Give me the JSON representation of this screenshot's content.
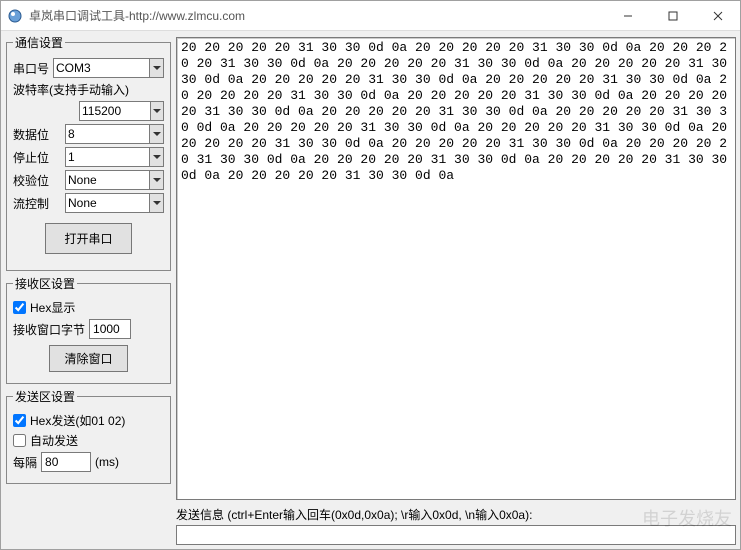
{
  "window": {
    "title": "卓岚串口调试工具-http://www.zlmcu.com"
  },
  "comm": {
    "legend": "通信设置",
    "port_label": "串口号",
    "port_value": "COM3",
    "baud_label": "波特率(支持手动输入)",
    "baud_value": "115200",
    "databits_label": "数据位",
    "databits_value": "8",
    "stopbits_label": "停止位",
    "stopbits_value": "1",
    "parity_label": "校验位",
    "parity_value": "None",
    "flow_label": "流控制",
    "flow_value": "None",
    "open_button": "打开串口"
  },
  "recv": {
    "legend": "接收区设置",
    "hex_display": "Hex显示",
    "hex_checked": true,
    "window_bytes_label": "接收窗口字节",
    "window_bytes_value": "1000",
    "clear_button": "清除窗口"
  },
  "send": {
    "legend": "发送区设置",
    "hex_send_label": "Hex发送(如01 02)",
    "hex_send_checked": true,
    "auto_send_label": "自动发送",
    "auto_send_checked": false,
    "interval_label": "每隔",
    "interval_value": "80",
    "interval_unit": "(ms)",
    "send_info_label": "发送信息 (ctrl+Enter输入回车(0x0d,0x0a); \\r输入0x0d, \\n输入0x0a):"
  },
  "recv_data": "20 20 20 20 20 31 30 30 0d 0a 20 20 20 20 20 31 30 30 0d 0a 20 20 20 20 20 31 30 30 0d 0a 20 20 20 20 20 31 30 30 0d 0a 20 20 20 20 20 31 30 30 0d 0a 20 20 20 20 20 31 30 30 0d 0a 20 20 20 20 20 31 30 30 0d 0a 20 20 20 20 20 31 30 30 0d 0a 20 20 20 20 20 31 30 30 0d 0a 20 20 20 20 20 31 30 30 0d 0a 20 20 20 20 20 31 30 30 0d 0a 20 20 20 20 20 31 30 30 0d 0a 20 20 20 20 20 31 30 30 0d 0a 20 20 20 20 20 31 30 30 0d 0a 20 20 20 20 20 31 30 30 0d 0a 20 20 20 20 20 31 30 30 0d 0a 20 20 20 20 20 31 30 30 0d 0a 20 20 20 20 20 31 30 30 0d 0a 20 20 20 20 20 31 30 30 0d 0a 20 20 20 20 20 31 30 30 0d 0a",
  "watermark": "电子发烧友"
}
